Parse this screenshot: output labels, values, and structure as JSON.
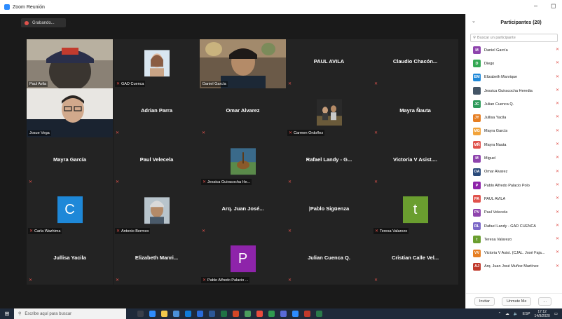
{
  "window": {
    "title": "Zoom Reunión",
    "minimize": "–",
    "restore": "◻"
  },
  "recording": {
    "label": "Grabando..."
  },
  "tiles": [
    {
      "name": "Paul Avila",
      "type": "video-cap"
    },
    {
      "name": "GAD Cuenca",
      "type": "photo-woman"
    },
    {
      "name": "Daniel García",
      "type": "video-man"
    },
    {
      "name": "PAUL AVILA",
      "type": "name"
    },
    {
      "name": "Claudio Chacón...",
      "type": "name"
    },
    {
      "name": "Josue Vega",
      "type": "video-glasses",
      "active": true
    },
    {
      "name": "Adrian Parra",
      "type": "name"
    },
    {
      "name": "Omar Alvarez",
      "type": "name"
    },
    {
      "name": "Carmen Ordoñez",
      "type": "photo-group"
    },
    {
      "name": "Mayra Ñauta",
      "type": "name"
    },
    {
      "name": "Mayra García",
      "type": "name"
    },
    {
      "name": "Paul Velecela",
      "type": "name"
    },
    {
      "name": "Jessica Guiracocha He...",
      "type": "photo-guitar"
    },
    {
      "name": "Rafael Landy - G...",
      "type": "name"
    },
    {
      "name": "Victoria V Asist....",
      "type": "name"
    },
    {
      "name": "Carla Wazhima",
      "type": "letter",
      "letter": "C",
      "color": "#1e88d8"
    },
    {
      "name": "Antonio Bermeo",
      "type": "photo-man"
    },
    {
      "name": "Arq. Juan José...",
      "type": "name"
    },
    {
      "name": "Pablo Sigüenza",
      "type": "name-pipe"
    },
    {
      "name": "Teresa Valarezo",
      "type": "letter",
      "letter": "t",
      "color": "#6a9e2f"
    },
    {
      "name": "Jullisa Yacila",
      "type": "name"
    },
    {
      "name": "Elizabeth Manri...",
      "type": "name"
    },
    {
      "name": "Pablo Alfredo Palacio ...",
      "type": "letter",
      "letter": "P",
      "color": "#8e24aa"
    },
    {
      "name": "Julian Cuenca Q.",
      "type": "name"
    },
    {
      "name": "Cristian Calle Vel...",
      "type": "name"
    }
  ],
  "panel": {
    "title": "Participantes (28)",
    "search_placeholder": "Buscar un participante",
    "participants": [
      {
        "initials": "M",
        "color": "#8e44ad",
        "name": "Daniel García"
      },
      {
        "initials": "D",
        "color": "#34a853",
        "name": "Diego"
      },
      {
        "initials": "EM",
        "color": "#1e88d8",
        "name": "Elizabeth Manrique"
      },
      {
        "initials": "",
        "color": "#445566",
        "name": "Jessica Guiracocha Heredia"
      },
      {
        "initials": "JC",
        "color": "#2e9a5a",
        "name": "Julian Cuenca Q."
      },
      {
        "initials": "JY",
        "color": "#e67e22",
        "name": "Jullisa Yacila"
      },
      {
        "initials": "MG",
        "color": "#f2a33a",
        "name": "Mayra García"
      },
      {
        "initials": "MÑ",
        "color": "#e0524c",
        "name": "Mayra Ñauta"
      },
      {
        "initials": "M",
        "color": "#8e44ad",
        "name": "Miguel"
      },
      {
        "initials": "OA",
        "color": "#2a4a7a",
        "name": "Omar Alvarez"
      },
      {
        "initials": "P",
        "color": "#8e24aa",
        "name": "Pablo Alfredo Palacio Polo"
      },
      {
        "initials": "PA",
        "color": "#e0524c",
        "name": "PAUL AVILA"
      },
      {
        "initials": "PV",
        "color": "#8e44ad",
        "name": "Paul Velecela"
      },
      {
        "initials": "RL",
        "color": "#7b68c8",
        "name": "Rafael Landy - GAD CUENCA"
      },
      {
        "initials": "t",
        "color": "#6a9e2f",
        "name": "Teresa Valarezo"
      },
      {
        "initials": "VV",
        "color": "#e67e22",
        "name": "Victoria V Asist. (CJAL. José Faja..."
      },
      {
        "initials": "AJ",
        "color": "#c0392b",
        "name": "Arq. Juan José Muñoz Martínez"
      }
    ],
    "invite_label": "Invitar",
    "unmute_label": "Unmute Me",
    "more_label": "..."
  },
  "taskbar": {
    "search_placeholder": "Escribe aquí para buscar",
    "lang": "ESP",
    "time": "17:12",
    "date": "14/9/2020"
  }
}
